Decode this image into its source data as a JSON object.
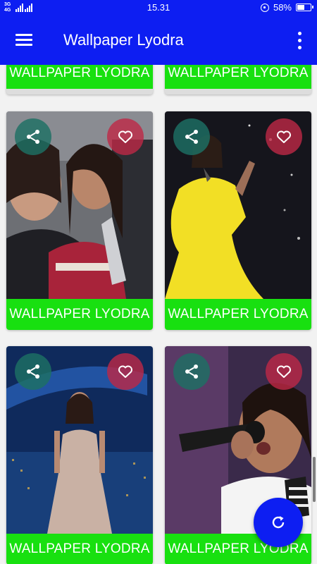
{
  "status_bar": {
    "network": "3G 4G",
    "time": "15.31",
    "battery": "58%",
    "battery_level": 0.58
  },
  "app_bar": {
    "title": "Wallpaper Lyodra",
    "menu_icon": "hamburger-menu-icon",
    "overflow_icon": "more-vert-icon"
  },
  "cards": [
    {
      "label": "WALLPAPER LYODRA"
    },
    {
      "label": "WALLPAPER LYODRA"
    },
    {
      "label": "WALLPAPER LYODRA",
      "share_icon": "share-icon",
      "favorite_icon": "heart-icon"
    },
    {
      "label": "WALLPAPER LYODRA",
      "share_icon": "share-icon",
      "favorite_icon": "heart-icon"
    },
    {
      "label": "WALLPAPER LYODRA",
      "share_icon": "share-icon",
      "favorite_icon": "heart-icon"
    },
    {
      "label": "WALLPAPER LYODRA",
      "share_icon": "share-icon",
      "favorite_icon": "heart-icon"
    }
  ],
  "fab": {
    "icon": "refresh-icon"
  },
  "colors": {
    "primary": "#0d1ef2",
    "label_green": "#18e010",
    "share_teal": "#1d7064",
    "favorite_red": "#be2846",
    "background": "#f2f2f2"
  }
}
